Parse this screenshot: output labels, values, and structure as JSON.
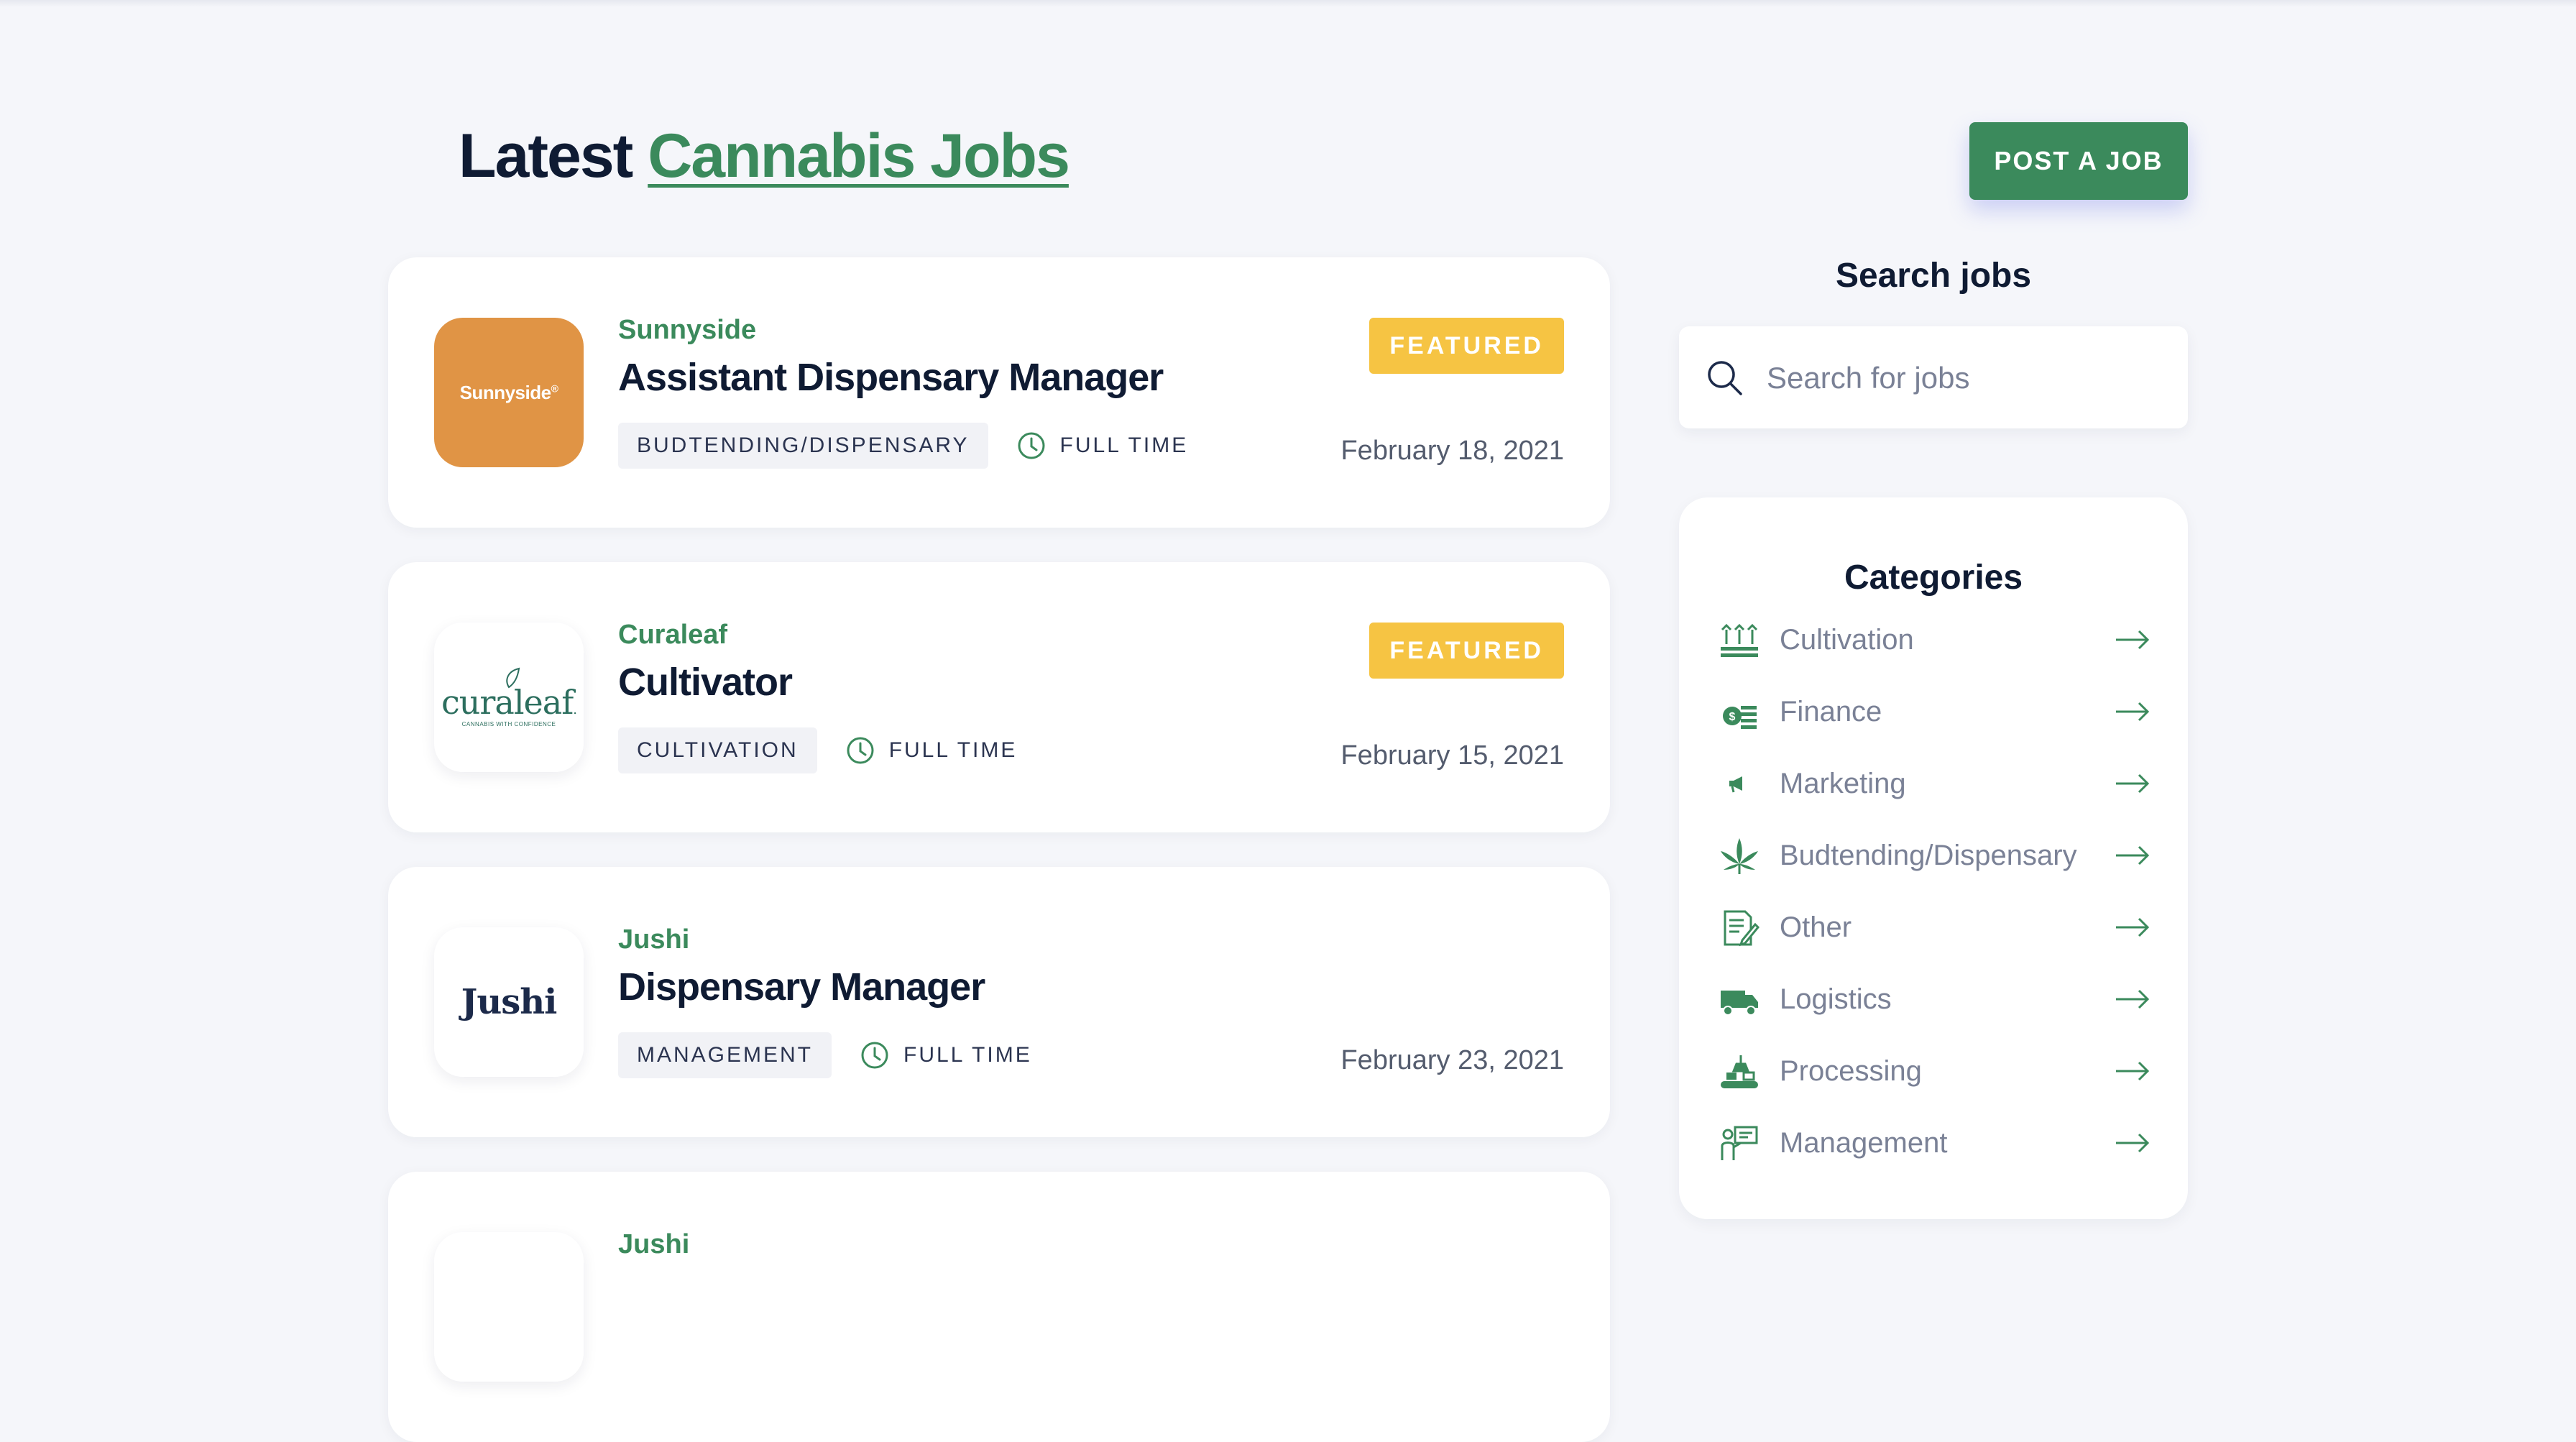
{
  "header": {
    "title_prefix": "Latest",
    "title_accent": "Cannabis Jobs",
    "post_button": "POST A JOB"
  },
  "jobs": [
    {
      "company": "Sunnyside",
      "logo_text": "Sunnyside",
      "logo_mark": "®",
      "title": "Assistant Dispensary Manager",
      "category": "BUDTENDING/DISPENSARY",
      "type": "FULL TIME",
      "badge": "FEATURED",
      "date": "February 18, 2021"
    },
    {
      "company": "Curaleaf",
      "logo_text": "curaleaf",
      "logo_mark": ".",
      "logo_tagline": "CANNABIS WITH CONFIDENCE",
      "title": "Cultivator",
      "category": "CULTIVATION",
      "type": "FULL TIME",
      "badge": "FEATURED",
      "date": "February 15, 2021"
    },
    {
      "company": "Jushi",
      "logo_text": "Jushi",
      "title": "Dispensary Manager",
      "category": "MANAGEMENT",
      "type": "FULL TIME",
      "date": "February 23, 2021"
    },
    {
      "company": "Jushi"
    }
  ],
  "search": {
    "title": "Search jobs",
    "placeholder": "Search for jobs"
  },
  "categories": {
    "title": "Categories",
    "items": [
      {
        "label": "Cultivation",
        "icon": "cultivation-icon"
      },
      {
        "label": "Finance",
        "icon": "finance-icon"
      },
      {
        "label": "Marketing",
        "icon": "marketing-icon"
      },
      {
        "label": "Budtending/Dispensary",
        "icon": "cannabis-leaf-icon"
      },
      {
        "label": "Other",
        "icon": "other-icon"
      },
      {
        "label": "Logistics",
        "icon": "truck-icon"
      },
      {
        "label": "Processing",
        "icon": "processing-icon"
      },
      {
        "label": "Management",
        "icon": "management-icon"
      }
    ]
  },
  "colors": {
    "accent": "#3b8a5c",
    "featured": "#f6c443",
    "sunnyside_logo_bg": "#e09445",
    "text_dark": "#0f1b33",
    "background": "#f5f6fa"
  }
}
